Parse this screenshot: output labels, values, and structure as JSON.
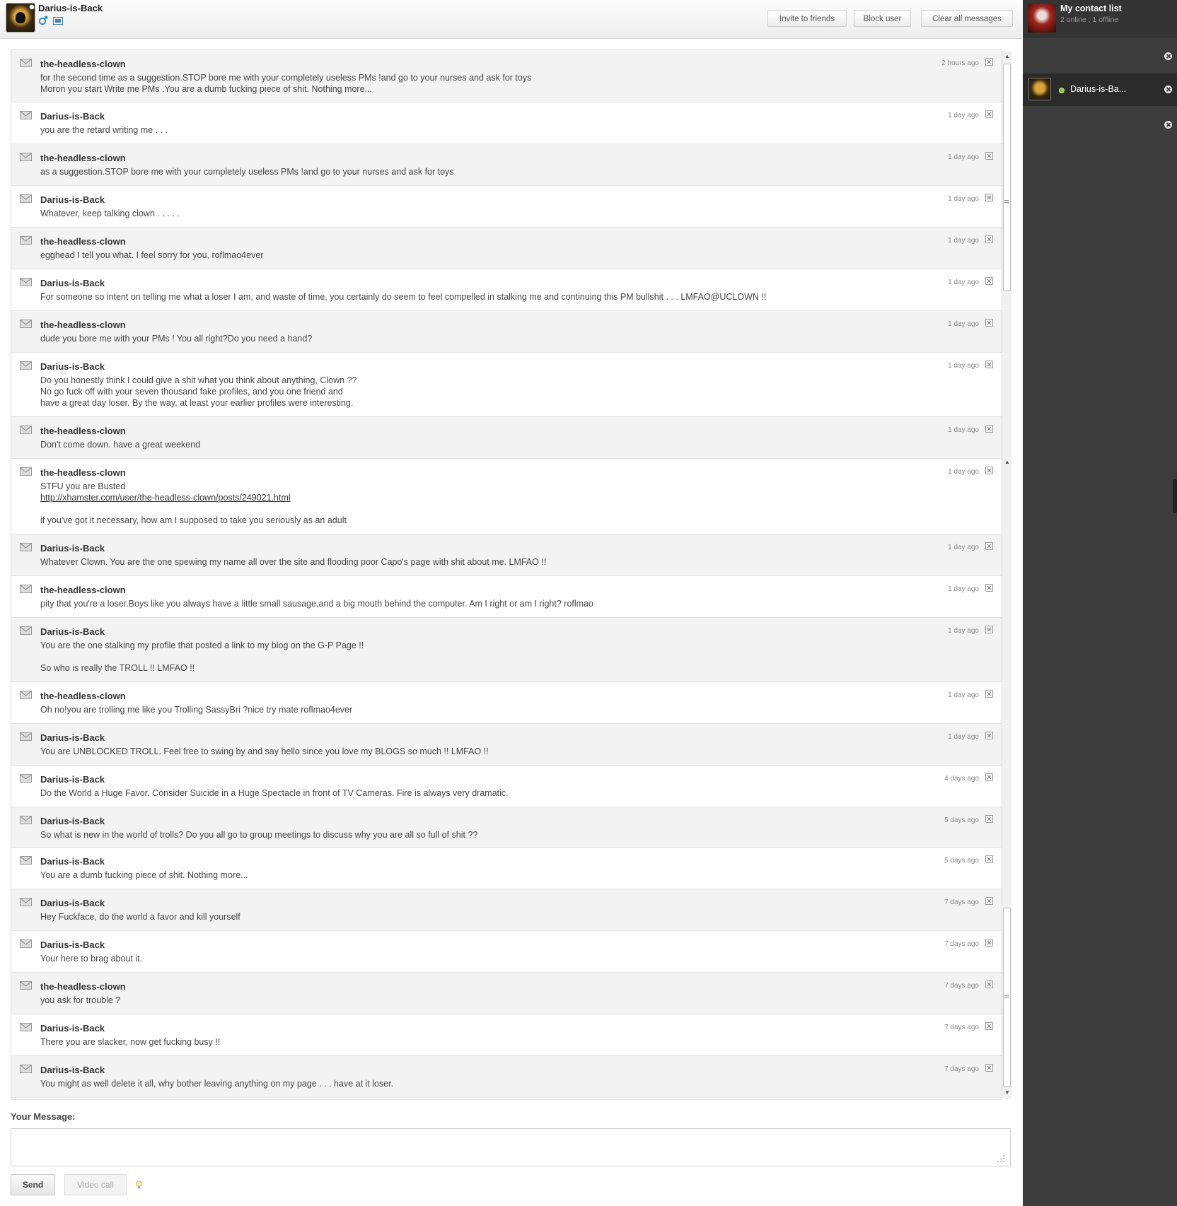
{
  "header": {
    "username": "Darius-is-Back",
    "buttons": {
      "invite": "Invite to friends",
      "block": "Block user",
      "clear": "Clear all messages"
    }
  },
  "messages": [
    {
      "author": "the-headless-clown",
      "time": "2 hours ago",
      "text": "for the second time as a suggestion.STOP bore me with your completely useless PMs !and go to your nurses and ask for toys\nMoron you start Write me PMs .You are a dumb fucking piece of shit. Nothing more..."
    },
    {
      "author": "Darius-is-Back",
      "time": "1 day ago",
      "text": "you are the retard writing me . . ."
    },
    {
      "author": "the-headless-clown",
      "time": "1 day ago",
      "text": "as a suggestion.STOP bore me with your completely useless PMs !and go to your nurses and ask for toys"
    },
    {
      "author": "Darius-is-Back",
      "time": "1 day ago",
      "text": "Whatever, keep talking clown . . . . ."
    },
    {
      "author": "the-headless-clown",
      "time": "1 day ago",
      "text": "egghead I tell you what. I feel sorry for you, roflmao4ever"
    },
    {
      "author": "Darius-is-Back",
      "time": "1 day ago",
      "text": "For someone so intent on telling me what a loser I am, and waste of time, you certainly do seem to feel compelled in stalking me and continuing this PM bullshit . . . LMFAO@UCLOWN !!"
    },
    {
      "author": "the-headless-clown",
      "time": "1 day ago",
      "text": "dude you bore me with your PMs ! You all right?Do you need a hand?"
    },
    {
      "author": "Darius-is-Back",
      "time": "1 day ago",
      "text": "Do you honestly think I could give a shit what you think about anything, Clown ??\nNo go fuck off with your seven thousand fake profiles, and you one friend and\nhave a great day loser. By the way, at least your earlier profiles were interesting."
    },
    {
      "author": "the-headless-clown",
      "time": "1 day ago",
      "text": "Don't come down. have a great weekend"
    },
    {
      "author": "the-headless-clown",
      "time": "1 day ago",
      "text": "STFU you are Busted",
      "link": "http://xhamster.com/user/the-headless-clown/posts/249021.html",
      "text2": "if you've got it necessary, how am I supposed to take you seriously as an adult"
    },
    {
      "author": "Darius-is-Back",
      "time": "1 day ago",
      "text": "Whatever Clown. You are the one spewing my name all over the site and flooding poor Capo's page with shit about me. LMFAO !!"
    },
    {
      "author": "the-headless-clown",
      "time": "1 day ago",
      "text": "pity that you're a loser.Boys like you always have a little small sausage,and a big mouth behind the computer. Am I right or am I right? roflmao"
    },
    {
      "author": "Darius-is-Back",
      "time": "1 day ago",
      "text": "You are the one stalking my profile that posted a link to my blog on the G-P Page !!\n\nSo who is really the TROLL !! LMFAO !!"
    },
    {
      "author": "the-headless-clown",
      "time": "1 day ago",
      "text": "Oh no!you are trolling me like you Trolling SassyBri ?nice try mate roflmao4ever"
    },
    {
      "author": "Darius-is-Back",
      "time": "1 day ago",
      "text": "You are UNBLOCKED TROLL. Feel free to swing by and say hello since you love my BLOGS so much !! LMFAO !!"
    },
    {
      "author": "Darius-is-Back",
      "time": "4 days ago",
      "text": "Do the World a Huge Favor. Consider Suicide in a Huge Spectacle in front of TV Cameras. Fire is always very dramatic."
    },
    {
      "author": "Darius-is-Back",
      "time": "5 days ago",
      "text": "So what is new in the world of trolls? Do you all go to group meetings to discuss why you are all so full of shit ??"
    },
    {
      "author": "Darius-is-Back",
      "time": "5 days ago",
      "text": "You are a dumb fucking piece of shit. Nothing more..."
    },
    {
      "author": "Darius-is-Back",
      "time": "7 days ago",
      "text": "Hey Fuckface, do the world a favor and kill yourself"
    },
    {
      "author": "Darius-is-Back",
      "time": "7 days ago",
      "text": "Your here to brag about it."
    },
    {
      "author": "the-headless-clown",
      "time": "7 days ago",
      "text": "you ask for trouble ?"
    },
    {
      "author": "Darius-is-Back",
      "time": "7 days ago",
      "text": "There you are slacker, now get fucking busy !!"
    },
    {
      "author": "Darius-is-Back",
      "time": "7 days ago",
      "text": "You might as well delete it all, why bother leaving anything on my page . . . have at it loser."
    }
  ],
  "composer": {
    "label": "Your Message:",
    "send_label": "Send",
    "video_label": "Video call"
  },
  "contacts": {
    "title": "My contact list",
    "status": "2 online ; 1 offline",
    "items": [
      {
        "name": "Darius-is-Ba...",
        "online": true
      }
    ]
  },
  "icons": {
    "gender": "male-icon",
    "photo": "photo-icon",
    "message": "envelope-icon",
    "delete": "delete-icon",
    "close": "close-icon",
    "hint": "lightbulb-icon"
  },
  "colors": {
    "sidebar_bg": "#3d3d3d",
    "online": "#8ac43f",
    "gender": "#2b8fd6"
  }
}
